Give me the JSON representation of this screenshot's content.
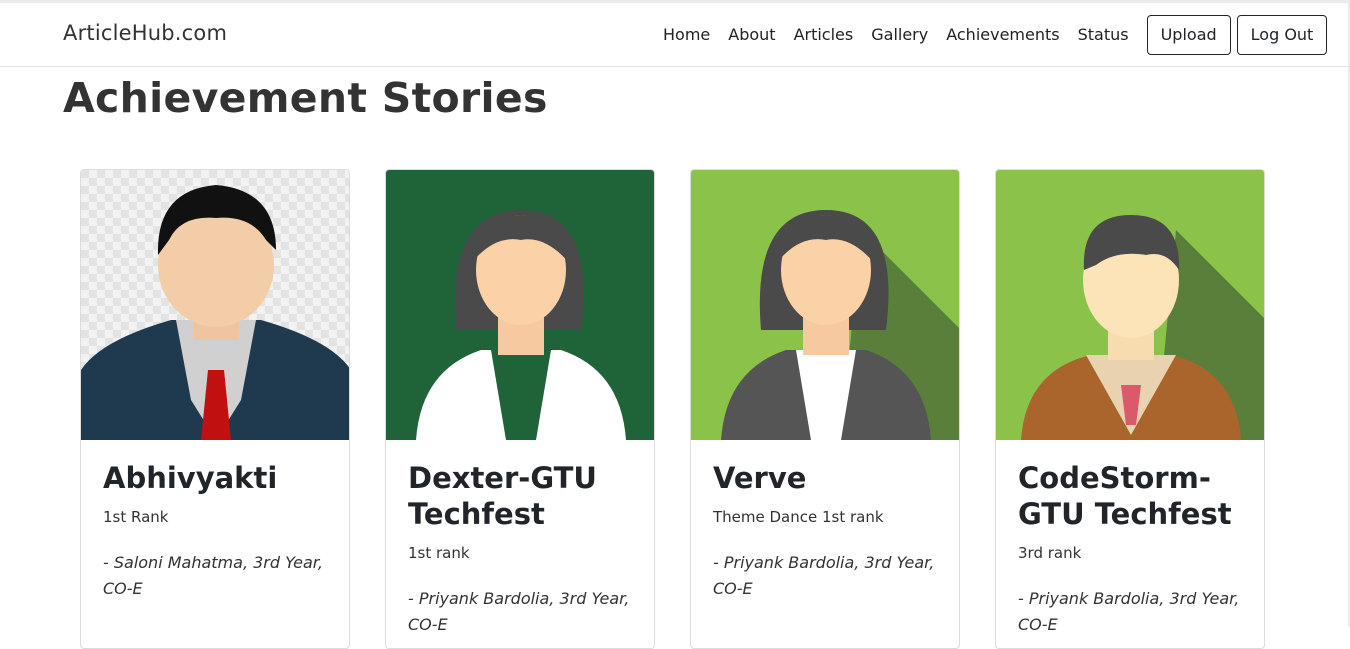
{
  "brand": "ArticleHub.com",
  "nav": {
    "links": [
      "Home",
      "About",
      "Articles",
      "Gallery",
      "Achievements",
      "Status"
    ],
    "upload_label": "Upload",
    "logout_label": "Log Out"
  },
  "page_title": "Achievement Stories",
  "cards": [
    {
      "title": "Abhivyakti",
      "rank": "1st Rank",
      "author": "- Saloni Mahatma, 3rd Year, CO-E",
      "avatar": "male-avatar-suit-red-tie",
      "bg": "#e9e9e9"
    },
    {
      "title": "Dexter-GTU Techfest",
      "rank": "1st rank",
      "author": "- Priyank Bardolia, 3rd Year, CO-E",
      "avatar": "female-avatar-white-shirt",
      "bg": "#1f6338"
    },
    {
      "title": "Verve",
      "rank": "Theme Dance 1st rank",
      "author": "- Priyank Bardolia, 3rd Year, CO-E",
      "avatar": "female-avatar-gray-blazer",
      "bg": "#8bc34a"
    },
    {
      "title": "CodeStorm-GTU Techfest",
      "rank": "3rd rank",
      "author": "- Priyank Bardolia, 3rd Year, CO-E",
      "avatar": "male-avatar-brown-sweater",
      "bg": "#8bc34a"
    }
  ]
}
